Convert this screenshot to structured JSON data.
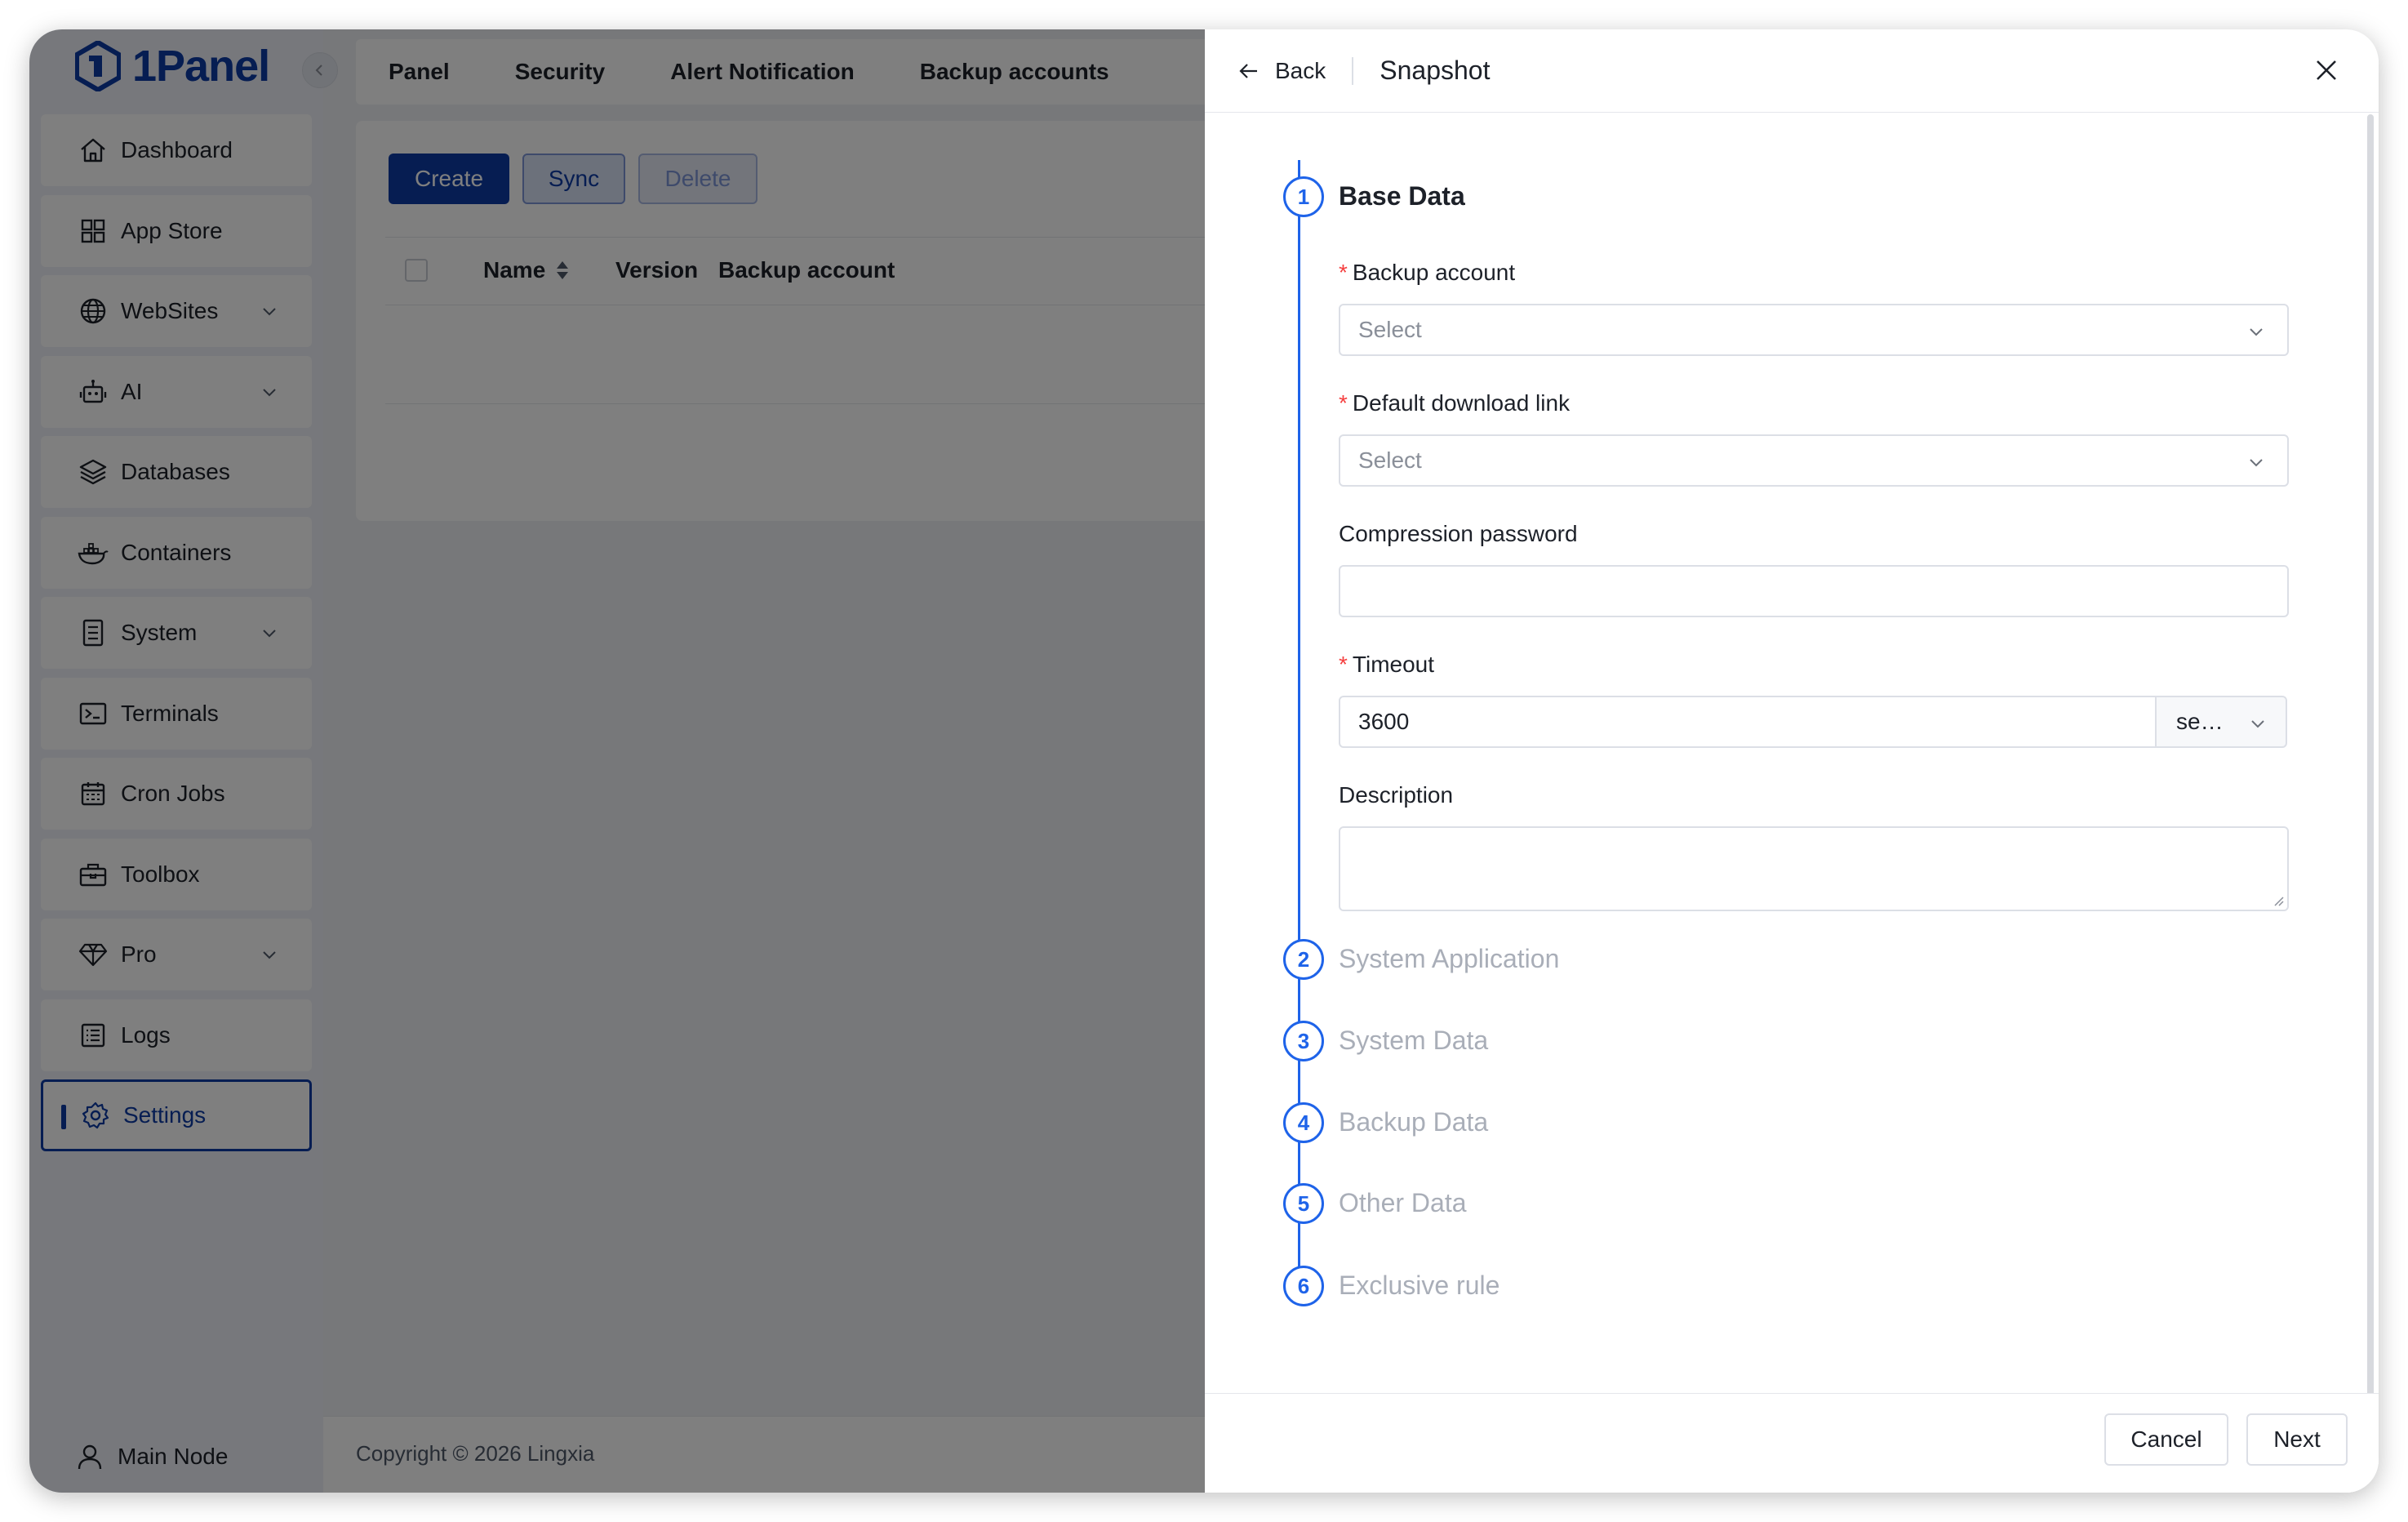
{
  "app": {
    "logo_text": "1Panel"
  },
  "sidebar": {
    "items": [
      {
        "label": "Dashboard",
        "icon": "home-icon"
      },
      {
        "label": "App Store",
        "icon": "grid-icon"
      },
      {
        "label": "WebSites",
        "icon": "globe-icon"
      },
      {
        "label": "AI",
        "icon": "robot-icon"
      },
      {
        "label": "Databases",
        "icon": "layers-icon"
      },
      {
        "label": "Containers",
        "icon": "docker-icon"
      },
      {
        "label": "System",
        "icon": "system-icon"
      },
      {
        "label": "Terminals",
        "icon": "terminal-icon"
      },
      {
        "label": "Cron Jobs",
        "icon": "calendar-icon"
      },
      {
        "label": "Toolbox",
        "icon": "toolbox-icon"
      },
      {
        "label": "Pro",
        "icon": "diamond-icon"
      },
      {
        "label": "Logs",
        "icon": "logs-icon"
      },
      {
        "label": "Settings",
        "icon": "gear-icon"
      }
    ],
    "user_label": "Main Node"
  },
  "header": {
    "tabs": [
      "Panel",
      "Security",
      "Alert Notification",
      "Backup accounts"
    ]
  },
  "toolbar": {
    "create": "Create",
    "sync": "Sync",
    "delete": "Delete"
  },
  "table": {
    "columns": [
      "Name",
      "Version",
      "Backup account"
    ]
  },
  "footer": {
    "copyright": "Copyright © 2026 Lingxia"
  },
  "drawer": {
    "back_label": "Back",
    "title": "Snapshot",
    "steps": [
      {
        "num": "1",
        "title": "Base Data"
      },
      {
        "num": "2",
        "title": "System Application"
      },
      {
        "num": "3",
        "title": "System Data"
      },
      {
        "num": "4",
        "title": "Backup Data"
      },
      {
        "num": "5",
        "title": "Other Data"
      },
      {
        "num": "6",
        "title": "Exclusive rule"
      }
    ],
    "form": {
      "backup_account_label": "Backup account",
      "backup_account_placeholder": "Select",
      "download_link_label": "Default download link",
      "download_link_placeholder": "Select",
      "compression_password_label": "Compression password",
      "compression_password_value": "",
      "timeout_label": "Timeout",
      "timeout_value": "3600",
      "timeout_unit": "se…",
      "description_label": "Description",
      "description_value": ""
    },
    "cancel_label": "Cancel",
    "next_label": "Next",
    "accent_color": "#1e63e9",
    "brand_color": "#0c3aa5"
  }
}
